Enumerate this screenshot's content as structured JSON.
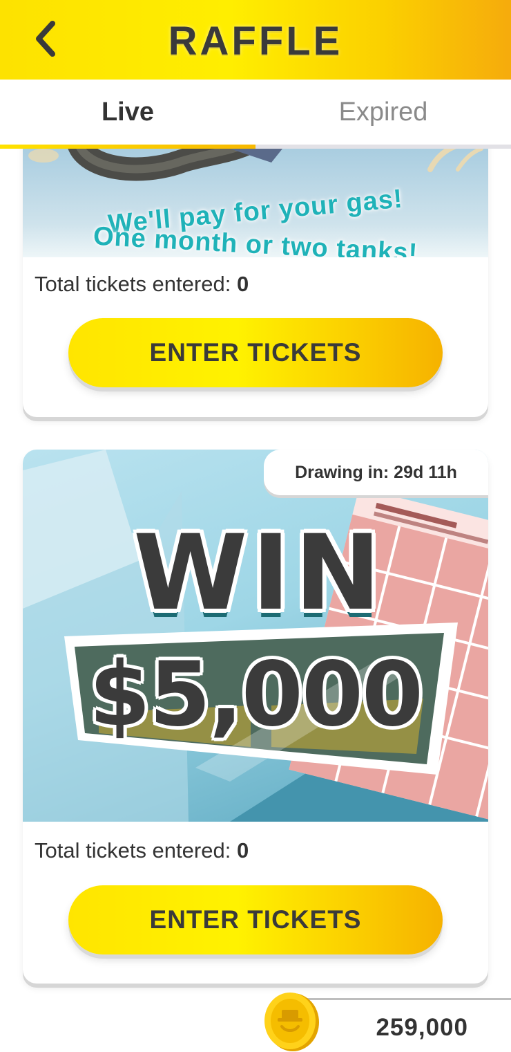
{
  "header": {
    "title": "RAFFLE",
    "back_icon": "chevron-left-icon",
    "colors": {
      "gradient_start": "#fde200",
      "gradient_end": "#f6ab0c",
      "title": "#3a3a3a"
    }
  },
  "tabs": [
    {
      "label": "Live",
      "active": true
    },
    {
      "label": "Expired",
      "active": false
    }
  ],
  "raffles": [
    {
      "banner_line1": "We'll pay for your gas!",
      "banner_line2": "One month or two tanks!",
      "tickets_label": "Total tickets entered:",
      "tickets_value": "0",
      "button_label": "ENTER TICKETS"
    },
    {
      "drawing_label": "Drawing in: 29d 11h",
      "banner_word": "WIN",
      "banner_prize": "$5,000",
      "tickets_label": "Total tickets entered:",
      "tickets_value": "0",
      "button_label": "ENTER TICKETS"
    }
  ],
  "wallet": {
    "coin_icon": "gold-coin-icon",
    "balance": "259,000"
  },
  "colors": {
    "accent_yellow": "#ffe500",
    "accent_orange": "#f6b200",
    "banner_teal_text": "#1fb2b8"
  }
}
